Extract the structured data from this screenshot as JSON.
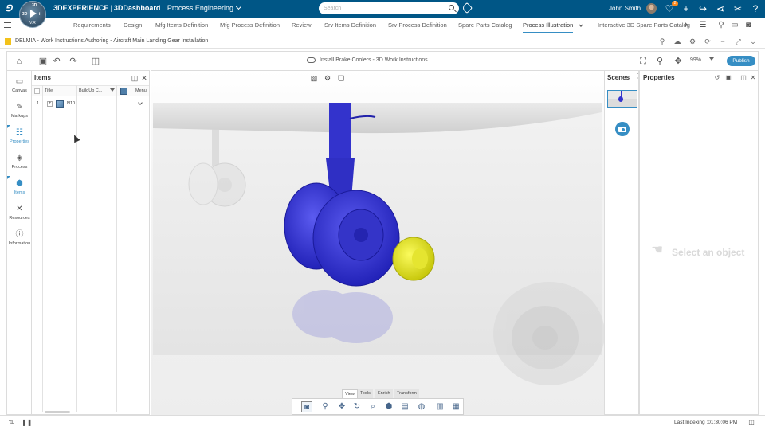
{
  "top_bar": {
    "brand": "3DEXPERIENCE",
    "dashboard": "3DDashboard",
    "app_name": "Process Engineering",
    "compass_version": "V.R",
    "search_placeholder": "Search",
    "user_name": "John Smith",
    "notification_count": "2"
  },
  "tabs": [
    {
      "label": "Requirements"
    },
    {
      "label": "Design"
    },
    {
      "label": "Mfg Items Definition"
    },
    {
      "label": "Mfg Process Definition"
    },
    {
      "label": "Review"
    },
    {
      "label": "Srv Items Definition"
    },
    {
      "label": "Srv Process Definition"
    },
    {
      "label": "Spare Parts Catalog"
    },
    {
      "label": "Process Illustration",
      "active": true
    },
    {
      "label": "Interactive 3D Spare Parts Catalog"
    }
  ],
  "document": {
    "title": "DELMIA - Work Instructions Authoring - Aircraft Main Landing Gear Installation"
  },
  "toolbar": {
    "title": "Install Brake Coolers - 3D Work Instructions",
    "zoom": "99%",
    "publish_label": "Publish"
  },
  "rail": [
    {
      "label": "Canvas",
      "icon": "canvas-icon"
    },
    {
      "label": "Markups",
      "icon": "markups-icon"
    },
    {
      "label": "Properties",
      "icon": "properties-icon",
      "selected": true
    },
    {
      "label": "Process",
      "icon": "process-icon"
    },
    {
      "label": "Items",
      "icon": "items-icon",
      "selected": true
    },
    {
      "label": "Resources",
      "icon": "resources-icon"
    },
    {
      "label": "Information",
      "icon": "information-icon"
    }
  ],
  "items_panel": {
    "title": "Items",
    "columns": [
      "Title",
      "BuildUp C...",
      "Menu"
    ],
    "rows": [
      {
        "num": "1",
        "title": "N10"
      }
    ]
  },
  "viewer": {
    "tabs": [
      "View",
      "Tools",
      "Enrich",
      "Transform"
    ],
    "active_tab": "View"
  },
  "scenes_panel": {
    "title": "Scenes"
  },
  "properties_panel": {
    "title": "Properties",
    "empty_message": "Select an object"
  },
  "status_bar": {
    "text": "Last Indexing :01:30:06 PM"
  },
  "colors": {
    "header_bg": "#005686",
    "accent": "#368ec4",
    "highlight_blue": "#3333cc",
    "highlight_yellow": "#e8e81a"
  }
}
